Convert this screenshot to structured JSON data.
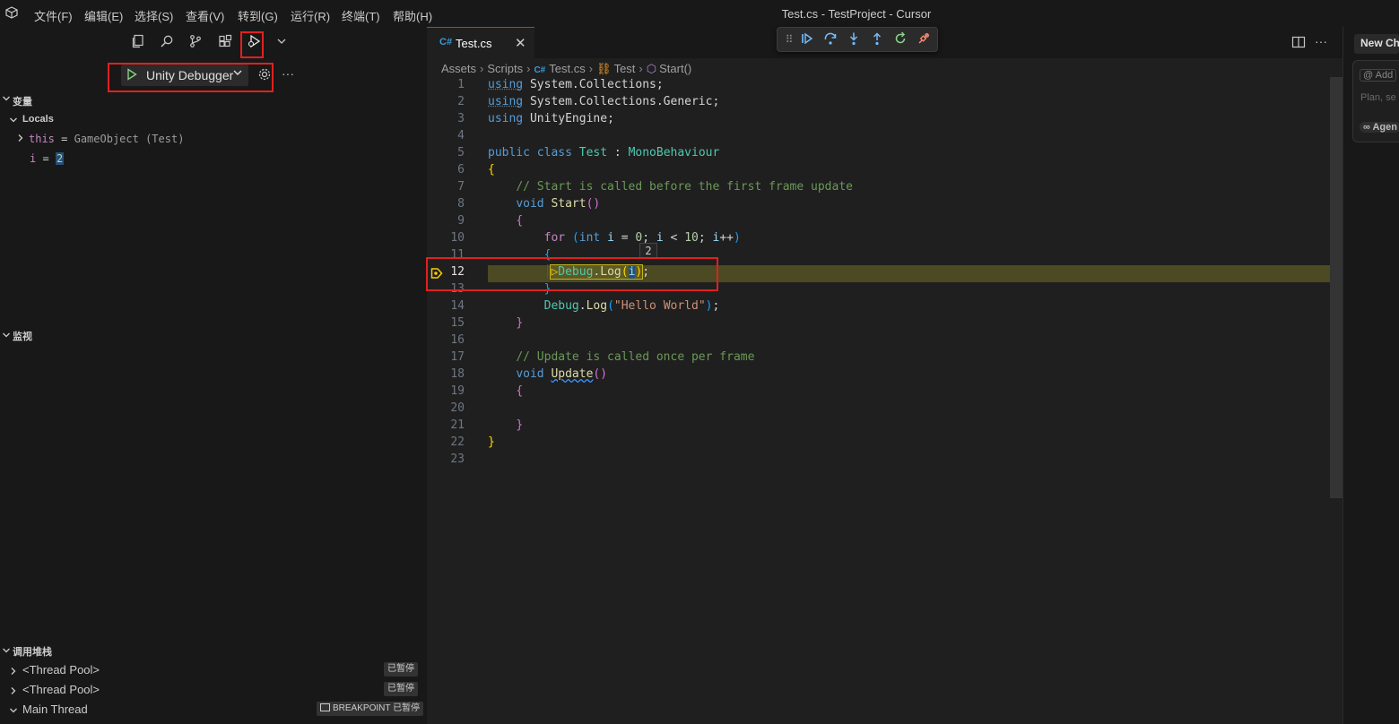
{
  "window": {
    "title": "Test.cs - TestProject - Cursor"
  },
  "menu": [
    "文件(F)",
    "编辑(E)",
    "选择(S)",
    "查看(V)",
    "转到(G)",
    "运行(R)",
    "终端(T)",
    "帮助(H)"
  ],
  "debug_view": {
    "config_name": "Unity Debugger",
    "variables_title": "变量",
    "locals_title": "Locals",
    "var_this_name": "this",
    "var_this_eq": "=",
    "var_this_value": "GameObject (Test)",
    "var_i_name": "i",
    "var_i_eq": "=",
    "var_i_value": "2",
    "watch_title": "监视",
    "callstack_title": "调用堆栈",
    "threads": [
      {
        "name": "<Thread Pool>",
        "status": "已暂停",
        "reason": ""
      },
      {
        "name": "<Thread Pool>",
        "status": "已暂停",
        "reason": ""
      },
      {
        "name": "Main Thread",
        "status": "已暂停",
        "reason": "BREAKPOINT"
      }
    ]
  },
  "editor": {
    "tab_label": "Test.cs",
    "breadcrumb": [
      "Assets",
      "Scripts",
      "Test.cs",
      "Test",
      "Start()"
    ],
    "hover_value": "2",
    "current_line": "12",
    "line_numbers": [
      "1",
      "2",
      "3",
      "4",
      "5",
      "6",
      "7",
      "8",
      "9",
      "10",
      "11",
      "12",
      "13",
      "14",
      "15",
      "16",
      "17",
      "18",
      "19",
      "20",
      "21",
      "22",
      "23"
    ]
  },
  "chat": {
    "tab_label": "New Ch",
    "add_label": "@ Add",
    "placeholder": "Plan, se",
    "mode_label": "∞ Agen"
  },
  "colors": {
    "accent": "#0078d4",
    "breakpoint_line": "#4b4a22",
    "highlight_box": "#e0211f"
  }
}
